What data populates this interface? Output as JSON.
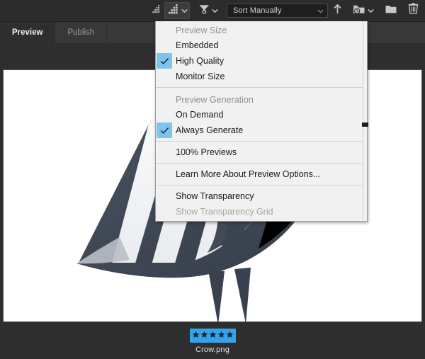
{
  "toolbar": {
    "thumbnail_small_icon": "thumbnail-size-small-icon",
    "thumbnail_large_icon": "thumbnail-size-large-icon",
    "filter_icon": "filter-funnel-icon",
    "sort_select_value": "Sort Manually",
    "sort_chevron_icon": "chevron-down-icon",
    "ascending_icon": "sort-ascending-arrow-icon",
    "recent_folders_icon": "recent-folders-icon",
    "new_folder_icon": "new-folder-icon",
    "delete_icon": "trash-delete-icon",
    "dropdown_chevron_icon": "chevron-down-icon"
  },
  "tabs": [
    {
      "label": "Preview",
      "active": true
    },
    {
      "label": "Publish",
      "active": false
    }
  ],
  "menu": {
    "sections": [
      {
        "header": "Preview Size",
        "items": [
          {
            "label": "Embedded",
            "checked": false,
            "disabled": false
          },
          {
            "label": "High Quality",
            "checked": true,
            "disabled": false
          },
          {
            "label": "Monitor Size",
            "checked": false,
            "disabled": false
          }
        ]
      },
      {
        "header": "Preview Generation",
        "items": [
          {
            "label": "On Demand",
            "checked": false,
            "disabled": false
          },
          {
            "label": "Always Generate",
            "checked": true,
            "disabled": false
          }
        ]
      },
      {
        "header": null,
        "items": [
          {
            "label": "100% Previews",
            "checked": false,
            "disabled": false
          }
        ]
      },
      {
        "header": null,
        "items": [
          {
            "label": "Learn More About Preview Options...",
            "checked": false,
            "disabled": false
          }
        ]
      },
      {
        "header": null,
        "items": [
          {
            "label": "Show Transparency",
            "checked": false,
            "disabled": false
          },
          {
            "label": "Show Transparency Grid",
            "checked": false,
            "disabled": true
          }
        ]
      }
    ],
    "check_icon": "checkmark-icon",
    "scrollbar_icon": "menu-scrollbar"
  },
  "file": {
    "name": "Crow.png",
    "rating": 5,
    "rating_max": 5,
    "star_icon": "star-icon"
  },
  "preview": {
    "image_alt": "crow-illustration"
  },
  "colors": {
    "accent_blue": "#35a3e8",
    "check_highlight": "#7ec5ee",
    "toolbar_bg": "#2c2c2c",
    "tabbar_bg": "#383838",
    "panel_bg": "#2e2e2e",
    "menu_bg": "#f1f1f1",
    "canvas_bg": "#ffffff",
    "bird_dark": "#3f4856",
    "bird_light": "#f2f3f5"
  }
}
